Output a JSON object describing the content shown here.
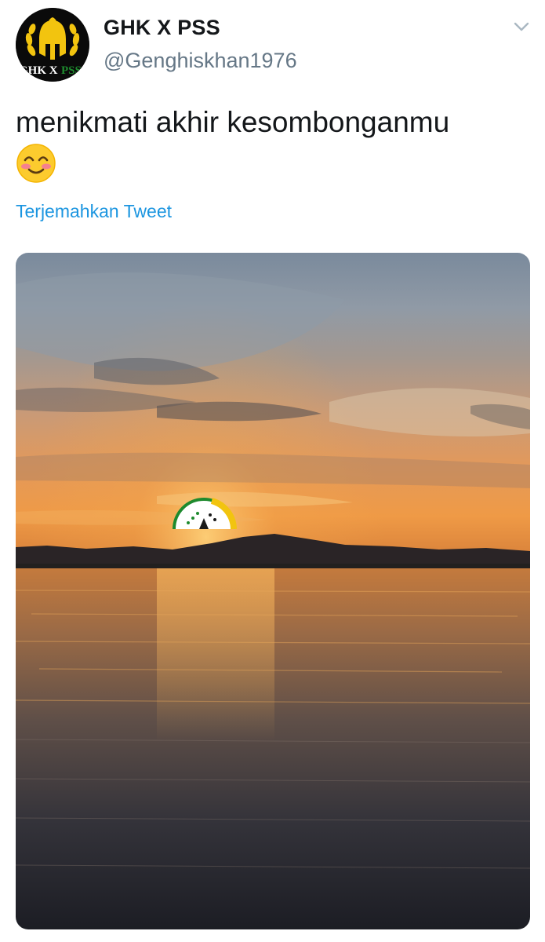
{
  "tweet": {
    "display_name": "GHK X PSS",
    "handle": "@Genghiskhan1976",
    "text": "menikmati akhir kesombonganmu",
    "emoji": "smiling-face-with-smiling-eyes",
    "translate_label": "Terjemahkan Tweet",
    "avatar_text": "GHK X PSS",
    "icons": {
      "caret": "chevron-down-icon"
    }
  },
  "colors": {
    "name": "#14171a",
    "handle": "#657786",
    "link": "#1b95e0",
    "avatar_bg": "#0a0a0a",
    "avatar_gold": "#f2c40f",
    "avatar_green": "#1e8a2e"
  }
}
